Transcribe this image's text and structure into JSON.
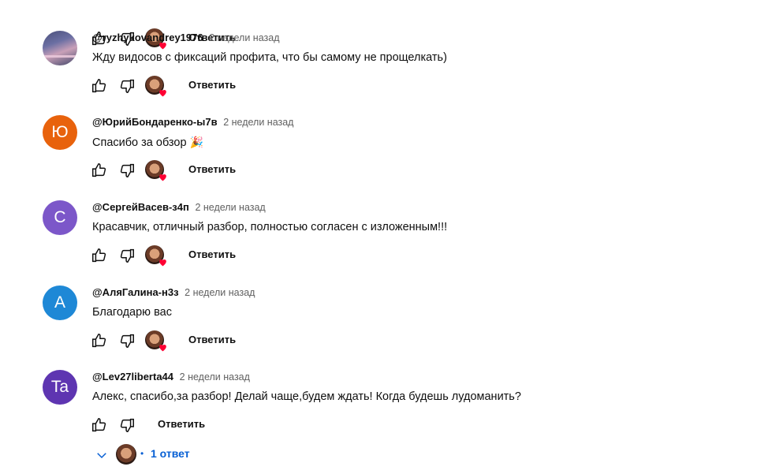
{
  "top_partial": {
    "reply_label": "Ответить"
  },
  "comments": [
    {
      "avatar_letter": "",
      "avatar_color": "#4a4f7a",
      "author": "@ryzhykovandrey1976",
      "time": "2 недели назад",
      "text": "Жду видосов с фиксаций профита, что бы самому не прощелкать)",
      "reply_label": "Ответить"
    },
    {
      "avatar_letter": "Ю",
      "avatar_color": "#e8620c",
      "author": "@ЮрийБондаренко-ы7в",
      "time": "2 недели назад",
      "text": "Спасибо за обзор",
      "emoji": "🎉",
      "reply_label": "Ответить"
    },
    {
      "avatar_letter": "С",
      "avatar_color": "#7c57c9",
      "author": "@СергейВасев-з4п",
      "time": "2 недели назад",
      "text": "Красавчик, отличный разбор, полностью согласен с изложенным!!!",
      "reply_label": "Ответить"
    },
    {
      "avatar_letter": "А",
      "avatar_color": "#1e88d6",
      "author": "@АляГалина-н3з",
      "time": "2 недели назад",
      "text": "Благодарю вас",
      "reply_label": "Ответить"
    },
    {
      "avatar_letter": "Ta",
      "avatar_color": "#5e35b1",
      "author": "@Lev27liberta44",
      "time": "2 недели назад",
      "text": "Алекс, спасибо,за разбор! Делай чаще,будем ждать! Когда будешь лудоманить?",
      "reply_label": "Ответить"
    }
  ],
  "replies_toggle": {
    "bullet": "•",
    "label": "1 ответ",
    "color": "#065fd4"
  },
  "icons": {
    "like": "thumb-up-icon",
    "dislike": "thumb-down-icon",
    "heart": "heart-icon",
    "chevron": "chevron-down-icon"
  }
}
